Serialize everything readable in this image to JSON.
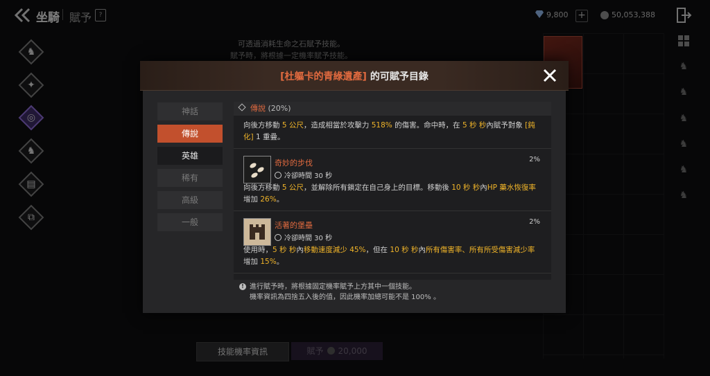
{
  "header": {
    "title": "坐騎",
    "subtitle": "賦予",
    "gems": "9,800",
    "coins": "50,053,388"
  },
  "background": {
    "info_line1": "可透過消耗生命之石賦予技能。",
    "info_line2": "賦予時，將根據一定機率賦予技能。",
    "rate_button": "技能機率資訊",
    "grant_button": "賦予",
    "grant_cost": "20,000"
  },
  "modal": {
    "title_highlight": "[杜軀卡的青綠遺產]",
    "title_rest": " 的可賦予目錄",
    "tabs": [
      {
        "label": "神話"
      },
      {
        "label": "傳說"
      },
      {
        "label": "英雄"
      },
      {
        "label": "稀有"
      },
      {
        "label": "高級"
      },
      {
        "label": "一般"
      }
    ],
    "selected_tab": "傳說",
    "section": {
      "grade": "傳說",
      "rate": "(20%)"
    },
    "top_desc": {
      "p1": "向後方移動 ",
      "h1": "5 公尺",
      "p2": "，造成相當於攻擊力 ",
      "h2": "518%",
      "p3": " 的傷害。命中時，在 ",
      "h3": "5 秒 秒",
      "p4": "內賦予對象 ",
      "h4": "[鈍化]",
      "p5": " 1 重疊。"
    },
    "skills": [
      {
        "name": "奇妙的步伐",
        "cooldown": "冷卻時間 30 秒",
        "rate": "2%",
        "desc": {
          "p1": "向後方移動 ",
          "h1": "5 公尺",
          "p2": "，並解除所有鎖定在自己身上的目標。移動後 ",
          "h2": "10 秒 秒",
          "p3": "內",
          "h3": "HP 藥水恢復率",
          "p4": "增加 ",
          "h4": "26%",
          "p5": "。"
        }
      },
      {
        "name": "活著的堡壘",
        "cooldown": "冷卻時間 30 秒",
        "rate": "2%",
        "desc": {
          "p1": "使用時，",
          "h1": "5 秒 秒",
          "p2": "內",
          "h2": "移動速度減少 45%",
          "p3": "，但在 ",
          "h3": "10 秒 秒",
          "p4": "內",
          "h4": "所有傷害率、所有所受傷害減少率",
          "p5": "增加 ",
          "h5": "15%",
          "p6": "。"
        }
      }
    ],
    "note_line1": "進行賦予時，將根據固定機率賦予上方其中一個技能。",
    "note_line2": "機率資訊為四捨五入後的值，因此機率加總可能不是 100% 。"
  },
  "colors": {
    "accent": "#e06a3f",
    "highlight": "#f0b429",
    "active_nav": "#3b2a63"
  }
}
